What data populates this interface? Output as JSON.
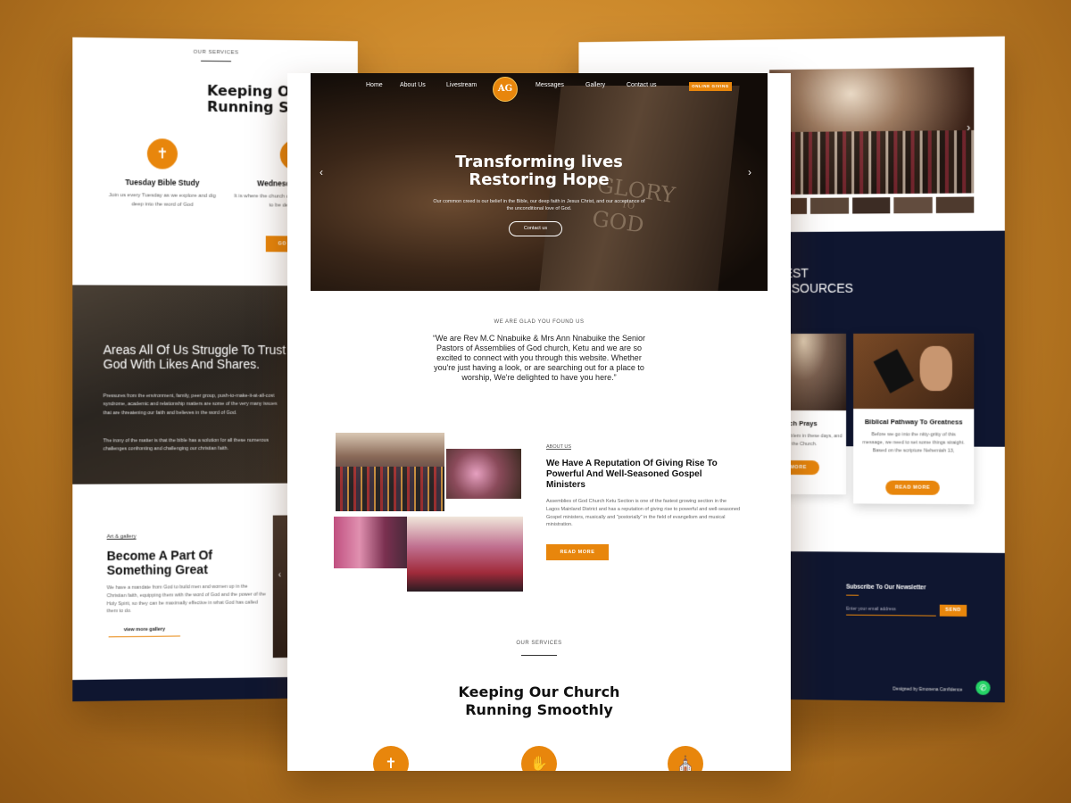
{
  "left": {
    "services_caption": "OUR SERVICES",
    "services_title": "Keeping Our Ch\nRunning Smoo",
    "card1": {
      "title": "Tuesday Bible Study",
      "text": "Join us every Tuesday as we explore and dig deep into the word of God"
    },
    "card2": {
      "title": "Wednesday Prayer M",
      "text": "It is where the church comes tog comfort, learn how to be devote answers."
    },
    "go_live": "GO LIVE",
    "struggle_title": "Areas All Of Us Struggle To Trust God With Likes And Shares.",
    "struggle_p1": "Pressures from the environment, family, peer group, push-to-make-it-at-all-cost syndrome, academic and relationship matters are some of the very many issues that are threatening our faith and believes in the word of God.",
    "struggle_p2": "The irony of the matter is that the bible has a solution for all these numerous challenges confronting and challenging our christian faith.",
    "gallery_caption": "Art & gallery",
    "gallery_title": "Become A Part Of Something Great",
    "gallery_text": "We have a mandate from God to build men and women up in the Christian faith, equipping them with the word of God and the power of the Holy Spirit, so they can be maximally effective in what God has called them to do.",
    "gallery_link": "view more gallery"
  },
  "center": {
    "nav": [
      "Home",
      "About Us",
      "Livestream",
      "Messages",
      "Gallery",
      "Contact us"
    ],
    "logo_text": "AG",
    "online_giving": "ONLINE GIVING",
    "hero_title_1": "Transforming lives",
    "hero_title_2": "Restoring Hope",
    "hero_text": "Our common creed is our belief in the Bible, our deep faith in Jesus Christ, and our acceptance of the unconditional love of God.",
    "hero_button": "Contact us",
    "book_text_1": "GLORY",
    "book_text_2": "TO",
    "book_text_3": "GOD",
    "welcome_caption": "WE ARE GLAD YOU FOUND US",
    "welcome_quote": "“We are Rev M.C Nnabuike & Mrs Ann Nnabuike the Senior Pastors of Assemblies of God church, Ketu and we are so excited to connect with you through this website. Whether you're just having a look, or are searching out for a place to worship, We're delighted to have you here.”",
    "about_caption": "ABOUT US",
    "about_title": "We Have A Reputation Of Giving Rise To Powerful And Well-Seasoned Gospel Ministers",
    "about_text": "Assemblies of God Church Ketu Section is one of the fastest growing section in the Lagos Mainland District and has a reputation of giving rise to powerful and well-seasoned Gospel ministers, musically and \"postorially\" in the field of evangelism and musical ministration.",
    "read_more": "READ MORE",
    "services_caption": "OUR SERVICES",
    "services_title_1": "Keeping Our Church",
    "services_title_2": "Running Smoothly"
  },
  "right": {
    "latest_1": "LATEST",
    "latest_2": "& RESOURCES",
    "card1_title": "he Church Prays",
    "card1_text": "one real problem in these days, and that is life of the Church.",
    "card1_btn": "AD MORE",
    "card2_title": "Biblical Pathway To Greatness",
    "card2_text": "Before we go into the nitty-gritty of this message, we need to set some things straight. Based on the scripture Nehemiah 13,",
    "card2_btn": "READ MORE",
    "newsletter_title": "Subscribe To Our Newsletter",
    "newsletter_placeholder": "Enter your email address",
    "send": "SEND",
    "credit": "Designed by Emonena Confidence"
  },
  "colors": {
    "accent": "#e8860c",
    "navy": "#0f1630"
  }
}
